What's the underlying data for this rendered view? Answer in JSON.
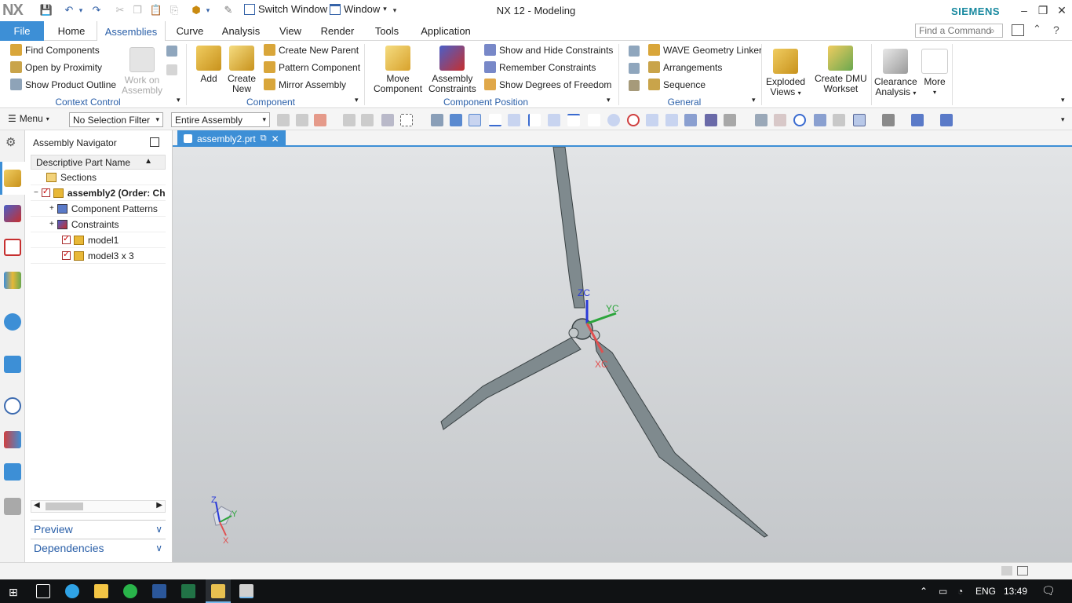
{
  "app": {
    "logo": "NX",
    "title": "NX 12 - Modeling",
    "brand": "SIEMENS"
  },
  "quick_access": {
    "switch_window": "Switch Window",
    "window": "Window"
  },
  "tabs": {
    "file": "File",
    "items": [
      "Home",
      "Assemblies",
      "Curve",
      "Analysis",
      "View",
      "Render",
      "Tools",
      "Application"
    ],
    "active": "Assemblies"
  },
  "search": {
    "placeholder": "Find a Command"
  },
  "ribbon": {
    "context_control": {
      "find_components": "Find Components",
      "open_by_proximity": "Open by Proximity",
      "show_product_outline": "Show Product Outline",
      "work_on_assembly_1": "Work on",
      "work_on_assembly_2": "Assembly",
      "group": "Context Control"
    },
    "component": {
      "add": "Add",
      "create_new_1": "Create",
      "create_new_2": "New",
      "create_new_parent": "Create New Parent",
      "pattern_component": "Pattern Component",
      "mirror_assembly": "Mirror Assembly",
      "group": "Component"
    },
    "component_position": {
      "move_component_1": "Move",
      "move_component_2": "Component",
      "assembly_constraints_1": "Assembly",
      "assembly_constraints_2": "Constraints",
      "show_hide_constraints": "Show and Hide Constraints",
      "remember_constraints": "Remember Constraints",
      "show_dof": "Show Degrees of Freedom",
      "group": "Component Position"
    },
    "general": {
      "wave_linker": "WAVE Geometry Linker",
      "arrangements": "Arrangements",
      "sequence": "Sequence",
      "group": "General"
    },
    "exploded_views_1": "Exploded",
    "exploded_views_2": "Views",
    "create_dmu_1": "Create DMU",
    "create_dmu_2": "Workset",
    "clearance_1": "Clearance",
    "clearance_2": "Analysis",
    "more": "More"
  },
  "selection_bar": {
    "menu": "Menu",
    "filter": "No Selection Filter",
    "scope": "Entire Assembly"
  },
  "navigator": {
    "title": "Assembly Navigator",
    "column": "Descriptive Part Name",
    "rows": [
      {
        "label": "Sections"
      },
      {
        "label": "assembly2 (Order: Ch"
      },
      {
        "label": "Component Patterns"
      },
      {
        "label": "Constraints"
      },
      {
        "label": "model1"
      },
      {
        "label": "model3 x 3"
      }
    ],
    "preview": "Preview",
    "dependencies": "Dependencies"
  },
  "document_tab": {
    "name": "assembly2.prt"
  },
  "viewport": {
    "wcs": {
      "z": "ZC",
      "y": "YC",
      "x": "XC"
    },
    "triad": {
      "z": "Z",
      "y": "Y",
      "x": "X"
    }
  },
  "taskbar": {
    "lang": "ENG",
    "time": "13:49"
  },
  "colors": {
    "accent": "#3d8fd6",
    "brand": "#1a8aa0",
    "blade": "#7f8a8e"
  }
}
